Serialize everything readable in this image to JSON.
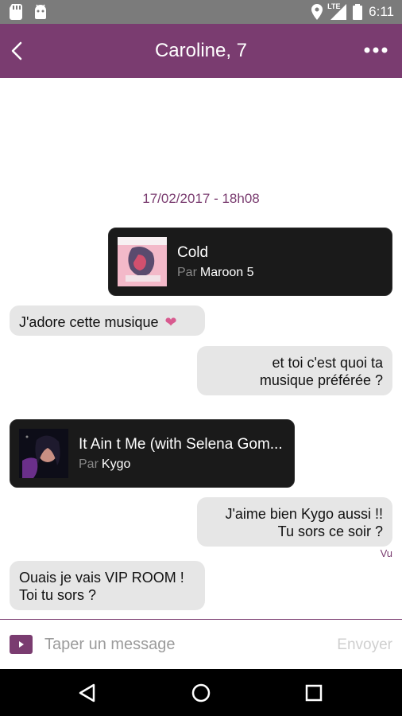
{
  "status_bar": {
    "network": "LTE",
    "time": "6:11"
  },
  "app_bar": {
    "title": "Caroline, 7",
    "icons": [
      "back-arrow-icon",
      "more-dots-icon"
    ]
  },
  "chat": {
    "date": "17/02/2017 - 18h08",
    "messages": [
      {
        "type": "music",
        "side": "right",
        "title": "Cold",
        "by_label": "Par",
        "artist": "Maroon 5"
      },
      {
        "type": "text",
        "side": "left",
        "text": "J'adore cette musique",
        "emoji": "❤"
      },
      {
        "type": "text",
        "side": "right",
        "lines": [
          "et toi c'est quoi ta",
          "musique préférée ?"
        ]
      },
      {
        "type": "music",
        "side": "left",
        "title": "It Ain t Me (with Selena Gom...",
        "by_label": "Par",
        "artist": "Kygo"
      },
      {
        "type": "text",
        "side": "right",
        "lines": [
          "J'aime bien Kygo aussi !!",
          "Tu sors ce soir ?"
        ]
      },
      {
        "type": "text",
        "side": "left",
        "lines": [
          "Ouais je vais VIP ROOM !",
          "Toi tu sors ?"
        ]
      }
    ],
    "read_receipt": "Vu"
  },
  "input_bar": {
    "placeholder": "Taper un message",
    "send_label": "Envoyer"
  },
  "colors": {
    "primary": "#7a3c70",
    "status_bar": "#7b7b7b",
    "bubble": "#e6e6e6",
    "music_card": "#1a1a1a",
    "heart": "#d85a8f"
  }
}
